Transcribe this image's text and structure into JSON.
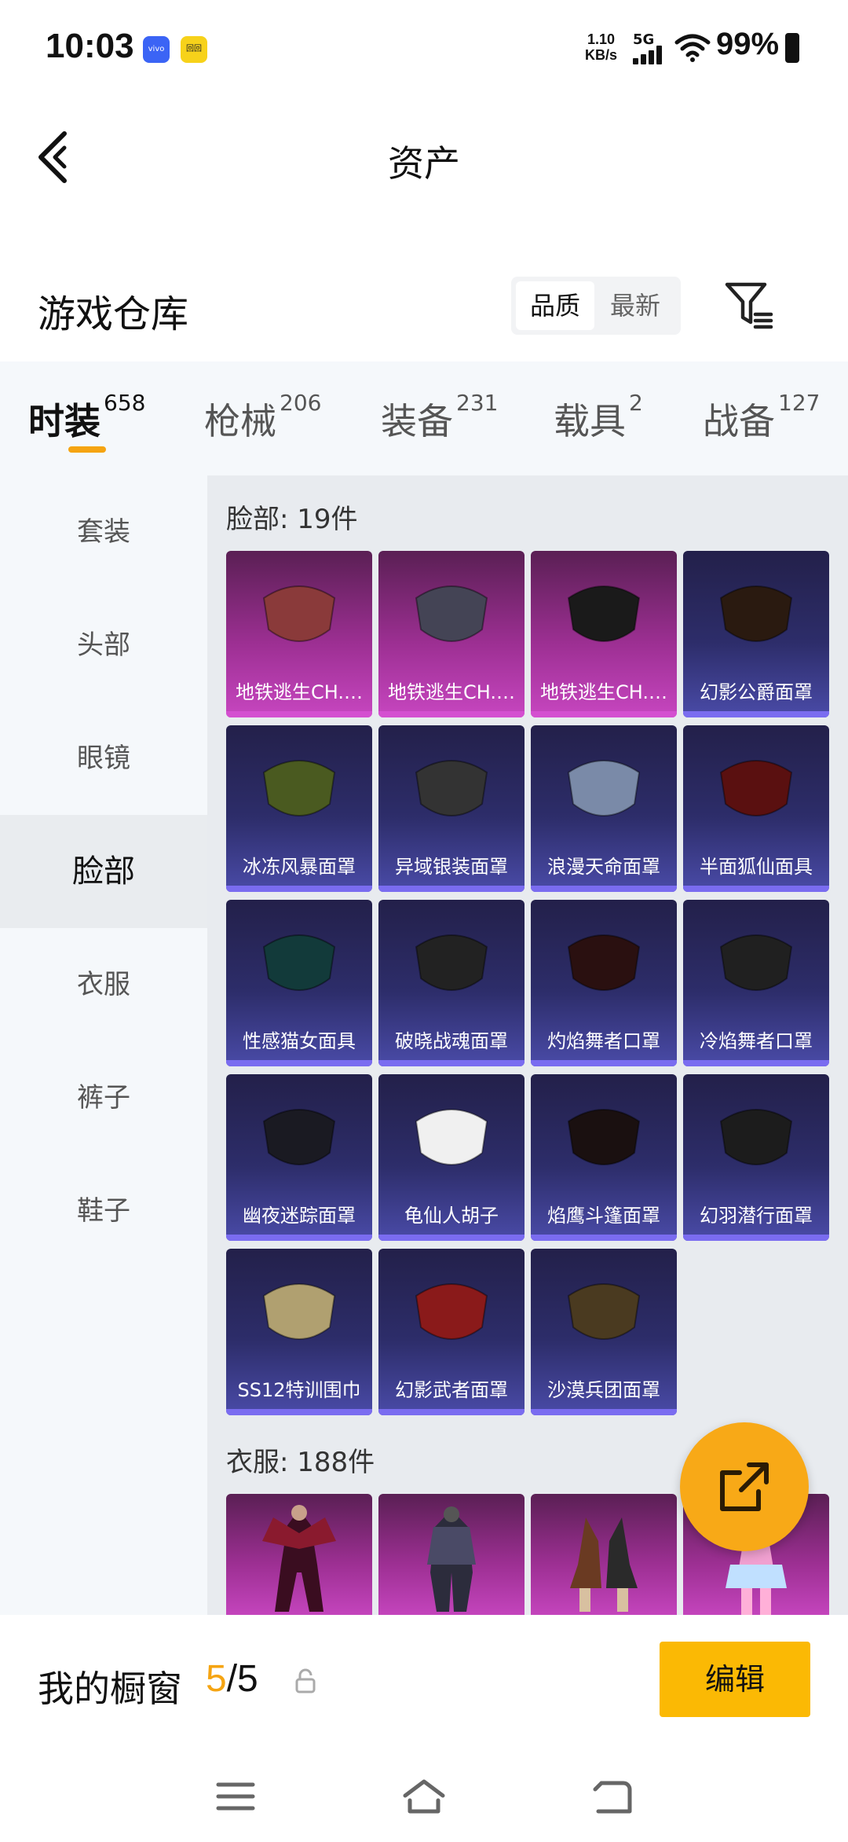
{
  "status": {
    "time": "10:03",
    "app_badge_1": "vivo",
    "app_badge_2": "回回",
    "speed_value": "1.10",
    "speed_unit": "KB/s",
    "network": "5G",
    "battery": "99%"
  },
  "header": {
    "title": "资产"
  },
  "warehouse": {
    "title": "游戏仓库",
    "sort_options": [
      "品质",
      "最新"
    ],
    "active_sort": "品质"
  },
  "categories": [
    {
      "label": "时装",
      "count": "658"
    },
    {
      "label": "枪械",
      "count": "206"
    },
    {
      "label": "装备",
      "count": "231"
    },
    {
      "label": "载具",
      "count": "2"
    },
    {
      "label": "战备",
      "count": "127"
    }
  ],
  "side_nav": [
    "套装",
    "头部",
    "眼镜",
    "脸部",
    "衣服",
    "裤子",
    "鞋子"
  ],
  "side_active": "脸部",
  "sections": [
    {
      "title": "脸部: 19件",
      "items": [
        {
          "name": "地铁逃生CH.…",
          "rarity": "purple"
        },
        {
          "name": "地铁逃生CH.…",
          "rarity": "purple"
        },
        {
          "name": "地铁逃生CH.…",
          "rarity": "purple"
        },
        {
          "name": "幻影公爵面罩",
          "rarity": "blue"
        },
        {
          "name": "冰冻风暴面罩",
          "rarity": "blue"
        },
        {
          "name": "异域银装面罩",
          "rarity": "blue"
        },
        {
          "name": "浪漫天命面罩",
          "rarity": "blue"
        },
        {
          "name": "半面狐仙面具",
          "rarity": "blue"
        },
        {
          "name": "性感猫女面具",
          "rarity": "blue"
        },
        {
          "name": "破晓战魂面罩",
          "rarity": "blue"
        },
        {
          "name": "灼焰舞者口罩",
          "rarity": "blue"
        },
        {
          "name": "冷焰舞者口罩",
          "rarity": "blue"
        },
        {
          "name": "幽夜迷踪面罩",
          "rarity": "blue"
        },
        {
          "name": "龟仙人胡子",
          "rarity": "blue"
        },
        {
          "name": "焰鹰斗篷面罩",
          "rarity": "blue"
        },
        {
          "name": "幻羽潜行面罩",
          "rarity": "blue"
        },
        {
          "name": "SS12特训围巾",
          "rarity": "blue"
        },
        {
          "name": "幻影武者面罩",
          "rarity": "blue"
        },
        {
          "name": "沙漠兵团面罩",
          "rarity": "blue"
        }
      ]
    },
    {
      "title": "衣服: 188件"
    }
  ],
  "showcase": {
    "title": "我的橱窗",
    "current": "5",
    "total": "/5",
    "edit_label": "编辑"
  },
  "colors": {
    "accent": "#f5a412",
    "button": "#fbb904",
    "purple_card": "#9c2f92",
    "blue_card": "#2d2d6a"
  }
}
